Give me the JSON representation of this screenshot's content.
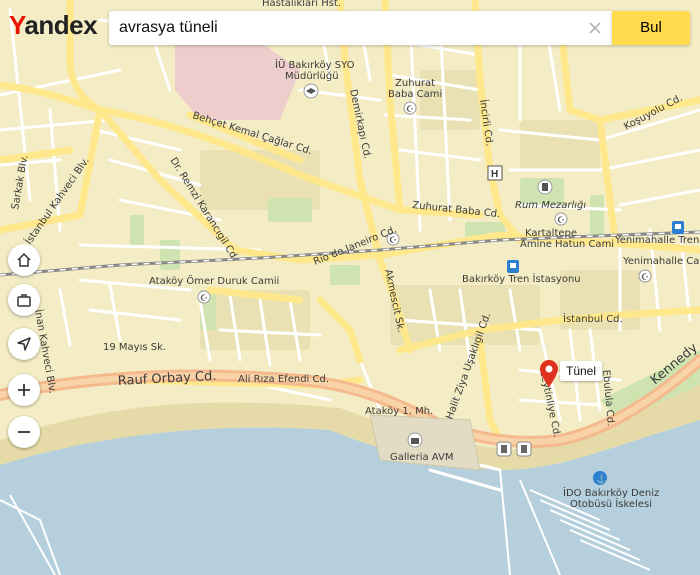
{
  "header": {
    "logo_first": "Y",
    "logo_rest": "andex",
    "search_value": "avrasya tüneli",
    "find_label": "Bul"
  },
  "map": {
    "labels": {
      "hastalikhari": "Hastalıkları Hst.",
      "iu_bakirkoy_syo_1": "İÜ Bakırköy SYO",
      "iu_bakirkoy_syo_2": "Müdürlüğü",
      "zuhurat_cami_1": "Zuhurat",
      "zuhurat_cami_2": "Baba Cami",
      "kosuyolu": "Koşuyolu Cd.",
      "behcet": "Behçet Kemal Çağlar Cd.",
      "demirkapi": "Demirkapı Cd.",
      "incirli": "İncirli Cd.",
      "remzi": "Dr. Remzi Karancıgil Cd.",
      "zuhurat_cd": "Zuhurat Baba Cd.",
      "rum_mezarligi": "Rum Mezarlığı",
      "kahveci": "İstanbul Kahveci Blv.",
      "rio": "Rio de Janeiro Cd.",
      "kartaltepe_1": "Kartaltepe",
      "kartaltepe_2": "Amine Hatun Cami",
      "yenimahalle_tren": "Yenimahalle Tren İs.",
      "yenimahalle_cami": "Yenimahalle Cami",
      "bakirkoy_tren": "Bakırköy Tren İstasyonu",
      "atakoy_omer": "Ataköy Ömer Duruk Camii",
      "akmescit": "Akmescit Sk.",
      "istanbul_cd": "İstanbul Cd.",
      "sarkak": "Sarkak Blv.",
      "nan_kahveci": "İnan Kahveci Blv.",
      "mayis": "19 Mayıs Sk.",
      "rauf": "Rauf Orbay Cd.",
      "ali_riza": "Ali Rıza Efendi Cd.",
      "halit": "Halit Ziya Uşaklıgil Cd.",
      "zeytinliye": "Zeytinliye Cd.",
      "ebulula": "Ebulula Cd.",
      "kennedy": "Kennedy",
      "atakoy_mah": "Ataköy 1. Mh.",
      "galleria": "Galleria AVM",
      "ido_1": "İDO Bakırköy Deniz",
      "ido_2": "Otobüsü İskelesi"
    },
    "pin_label": "Tünel"
  },
  "controls": {
    "home": "home-icon",
    "briefcase": "briefcase-icon",
    "locate": "locate-icon",
    "zoom_in": "zoom-in-icon",
    "zoom_out": "zoom-out-icon"
  }
}
